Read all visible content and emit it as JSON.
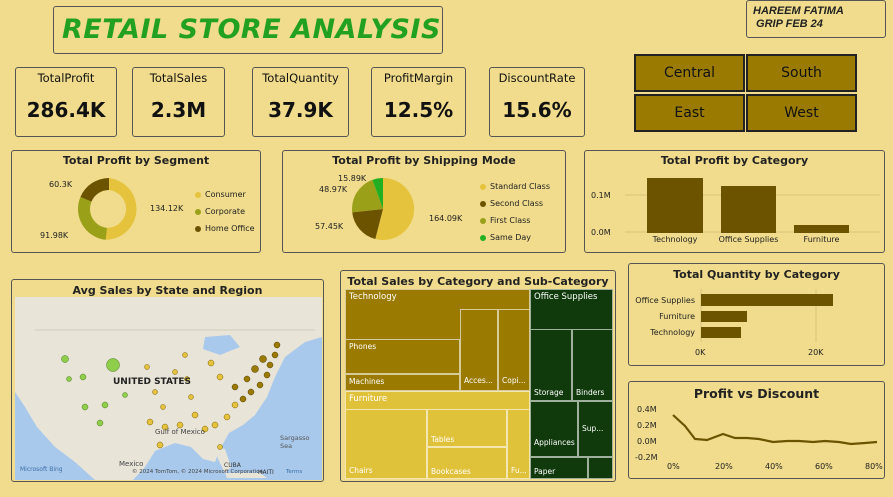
{
  "header": {
    "title": "RETAIL STORE ANALYSIS",
    "author_line1": "HAREEM FATIMA",
    "author_line2": " GRIP FEB 24"
  },
  "kpis": [
    {
      "label": "TotalProfit",
      "value": "286.4K"
    },
    {
      "label": "TotalSales",
      "value": "2.3M"
    },
    {
      "label": "TotalQuantity",
      "value": "37.9K"
    },
    {
      "label": "ProfitMargin",
      "value": "12.5%"
    },
    {
      "label": "DiscountRate",
      "value": "15.6%"
    }
  ],
  "regions": [
    "Central",
    "South",
    "East",
    "West"
  ],
  "segment_chart": {
    "title": "Total Profit by Segment",
    "labels": [
      "60.3K",
      "134.12K",
      "91.98K"
    ],
    "legend": [
      "Consumer",
      "Corporate",
      "Home Office"
    ]
  },
  "shipping_chart": {
    "title": "Total Profit by Shipping Mode",
    "labels": [
      "15.89K",
      "48.97K",
      "57.45K",
      "164.09K"
    ],
    "legend": [
      "Standard Class",
      "Second Class",
      "First Class",
      "Same Day"
    ]
  },
  "category_chart": {
    "title": "Total Profit by Category",
    "yticks": [
      "0.1M",
      "0.0M"
    ],
    "categories": [
      "Technology",
      "Office Supplies",
      "Furniture"
    ]
  },
  "map": {
    "title": "Avg Sales by State and Region",
    "country": "UNITED STATES",
    "mexico": "Mexico",
    "gulf": "Gulf of\nMexico",
    "sargasso": "Sargasso Sea",
    "cuba": "CUBA",
    "haiti": "HAITI",
    "bing": "Microsoft Bing",
    "credit": "© 2024 TomTom, © 2024 Microsoft Corporation",
    "terms": "Terms"
  },
  "treemap": {
    "title": "Total Sales by Category and Sub-Category",
    "labels": {
      "technology": "Technology",
      "phones": "Phones",
      "machines": "Machines",
      "accessories": "Acces...",
      "copiers": "Copi...",
      "furniture": "Furniture",
      "chairs": "Chairs",
      "tables": "Tables",
      "bookcases": "Bookcases",
      "furnishings": "Fu...",
      "office": "Office Supplies",
      "storage": "Storage",
      "binders": "Binders",
      "appliances": "Appliances",
      "supplies": "Sup...",
      "paper": "Paper"
    }
  },
  "quantity_chart": {
    "title": "Total Quantity by Category",
    "categories": [
      "Office Supplies",
      "Furniture",
      "Technology"
    ],
    "xticks": [
      "0K",
      "20K"
    ]
  },
  "discount_chart": {
    "title": "Profit vs Discount",
    "yticks": [
      "0.4M",
      "0.2M",
      "0.0M",
      "-0.2M"
    ],
    "xticks": [
      "0%",
      "20%",
      "40%",
      "60%",
      "80%"
    ]
  },
  "chart_data": [
    {
      "type": "pie",
      "title": "Total Profit by Segment",
      "labels": [
        "Consumer",
        "Corporate",
        "Home Office"
      ],
      "values": [
        134.12,
        91.98,
        60.3
      ]
    },
    {
      "type": "pie",
      "title": "Total Profit by Shipping Mode",
      "labels": [
        "Standard Class",
        "Second Class",
        "First Class",
        "Same Day"
      ],
      "values": [
        164.09,
        57.45,
        48.97,
        15.89
      ]
    },
    {
      "type": "bar",
      "title": "Total Profit by Category",
      "categories": [
        "Technology",
        "Office Supplies",
        "Furniture"
      ],
      "values": [
        145.45,
        122.49,
        18.45
      ],
      "ylim": [
        0,
        0.15
      ]
    },
    {
      "type": "bar",
      "title": "Total Quantity by Category",
      "categories": [
        "Office Supplies",
        "Furniture",
        "Technology"
      ],
      "values": [
        22.9,
        8.0,
        6.9
      ],
      "xlim": [
        0,
        30
      ]
    },
    {
      "type": "line",
      "title": "Profit vs Discount",
      "x": [
        0,
        5,
        10,
        15,
        20,
        25,
        30,
        35,
        40,
        45,
        50,
        55,
        60,
        65,
        70,
        75,
        80
      ],
      "values": [
        0.32,
        0.15,
        0.02,
        0.01,
        0.09,
        0.03,
        0.04,
        0.02,
        -0.02,
        -0.01,
        -0.01,
        -0.02,
        -0.01,
        -0.02,
        -0.04,
        -0.03,
        -0.02
      ],
      "ylim": [
        -0.2,
        0.4
      ]
    }
  ]
}
